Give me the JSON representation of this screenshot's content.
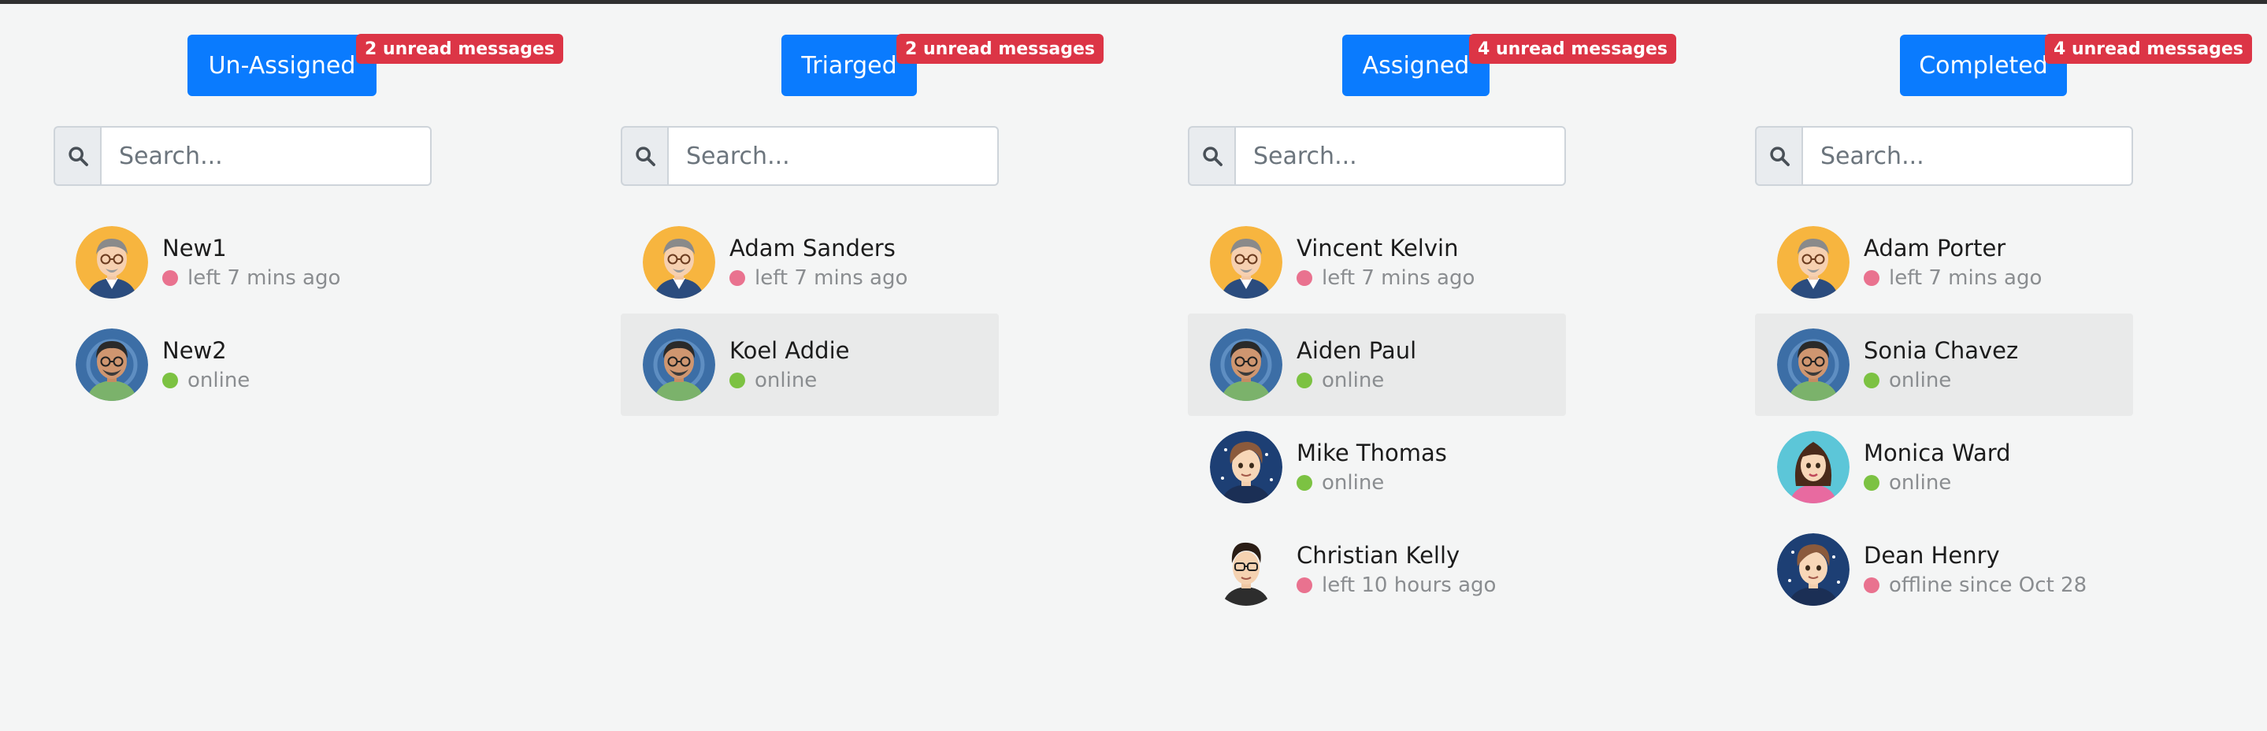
{
  "search_placeholder": "Search...",
  "icons": {
    "search": "search-icon"
  },
  "colors": {
    "primary": "#0a7bfe",
    "badge": "#dc3546",
    "online": "#7cc242",
    "away": "#e9728f"
  },
  "columns": [
    {
      "label": "Un-Assigned",
      "badge": "2 unread messages",
      "people": [
        {
          "name": "New1",
          "status": "left 7 mins ago",
          "online": false
        },
        {
          "name": "New2",
          "status": "online",
          "online": true
        }
      ]
    },
    {
      "label": "Triarged",
      "badge": "2 unread messages",
      "people": [
        {
          "name": "Adam Sanders",
          "status": "left 7 mins ago",
          "online": false
        },
        {
          "name": "Koel Addie",
          "status": "online",
          "online": true,
          "selected": true
        }
      ]
    },
    {
      "label": "Assigned",
      "badge": "4 unread messages",
      "people": [
        {
          "name": "Vincent Kelvin",
          "status": "left 7 mins ago",
          "online": false
        },
        {
          "name": "Aiden Paul",
          "status": "online",
          "online": true,
          "selected": true
        },
        {
          "name": "Mike Thomas",
          "status": "online",
          "online": true
        },
        {
          "name": "Christian Kelly",
          "status": "left 10 hours ago",
          "online": false
        }
      ]
    },
    {
      "label": "Completed",
      "badge": "4 unread messages",
      "people": [
        {
          "name": "Adam Porter",
          "status": "left 7 mins ago",
          "online": false
        },
        {
          "name": "Sonia Chavez",
          "status": "online",
          "online": true,
          "selected": true
        },
        {
          "name": "Monica Ward",
          "status": "online",
          "online": true
        },
        {
          "name": "Dean Henry",
          "status": "offline since Oct 28",
          "online": false
        }
      ]
    }
  ]
}
